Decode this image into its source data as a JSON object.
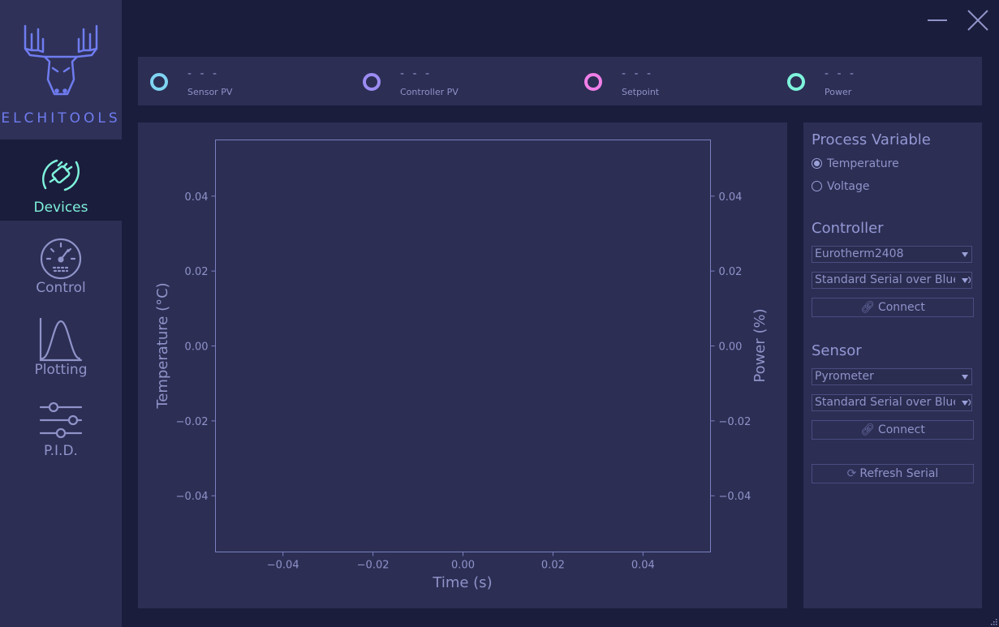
{
  "app": {
    "logo_text": "ELCHITOOLS"
  },
  "nav": {
    "items": [
      {
        "label": "Devices",
        "icon": "plug-icon",
        "active": true
      },
      {
        "label": "Control",
        "icon": "gauge-icon",
        "active": false
      },
      {
        "label": "Plotting",
        "icon": "bell-curve-icon",
        "active": false
      },
      {
        "label": "P.I.D.",
        "icon": "sliders-icon",
        "active": false
      }
    ]
  },
  "readouts": [
    {
      "value": "- - -",
      "label": "Sensor PV",
      "color": "#7fd4f2"
    },
    {
      "value": "- - -",
      "label": "Controller PV",
      "color": "#9b8cf2"
    },
    {
      "value": "- - -",
      "label": "Setpoint",
      "color": "#f07fe8"
    },
    {
      "value": "- - -",
      "label": "Power",
      "color": "#7ef3dc"
    }
  ],
  "chart_data": {
    "type": "line",
    "xlabel": "Time (s)",
    "ylabel": "Temperature (°C)",
    "ylabel_right": "Power (%)",
    "xlim": [
      -0.055,
      0.055
    ],
    "ylim": [
      -0.055,
      0.055
    ],
    "x_ticks": [
      -0.04,
      -0.02,
      0.0,
      0.02,
      0.04
    ],
    "y_ticks": [
      0.04,
      0.02,
      0.0,
      -0.02,
      -0.04
    ],
    "tick_labels": [
      "−0.04",
      "−0.02",
      "0.00",
      "0.02",
      "0.04"
    ],
    "series": [],
    "grid": false
  },
  "controls": {
    "process_variable": {
      "title": "Process Variable",
      "options": [
        {
          "label": "Temperature",
          "selected": true
        },
        {
          "label": "Voltage",
          "selected": false
        }
      ]
    },
    "controller": {
      "title": "Controller",
      "device": "Eurotherm2408",
      "connection": "Standard Serial over Blueto",
      "connect_label": "Connect"
    },
    "sensor": {
      "title": "Sensor",
      "device": "Pyrometer",
      "connection": "Standard Serial over Blueto",
      "connect_label": "Connect"
    },
    "refresh_label": "Refresh Serial"
  }
}
